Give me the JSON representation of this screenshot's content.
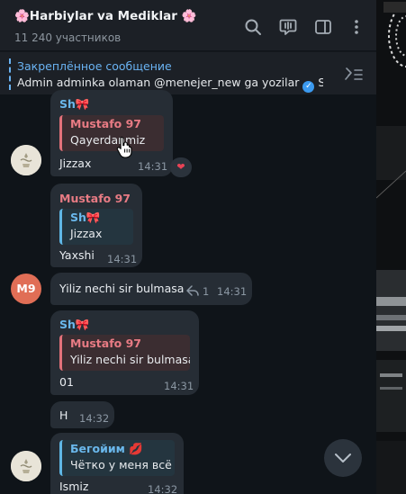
{
  "header": {
    "title": "🌸Harbiylar va Mediklar 🌸",
    "subtitle": "11 240 участников",
    "icons": [
      "search-icon",
      "live-chat-icon",
      "side-panel-icon",
      "more-vert-icon"
    ]
  },
  "pinned": {
    "title": "Закреплённое сообщение",
    "text_before": "Admin adminka olaman @menejer_new ga yozilar ",
    "text_after": " S..."
  },
  "messages": [
    {
      "sender": "Sh🎀",
      "reply_name": "Mustafo 97",
      "reply_text": "Qayerdanmiz",
      "text": "Jizzax",
      "time": "14:31",
      "reaction": "❤"
    },
    {
      "sender": "Mustafo 97",
      "reply_name": "Sh🎀",
      "reply_text": "Jizzax",
      "text": "Yaxshi",
      "time": "14:31"
    },
    {
      "avatar": "M9",
      "text": "Yiliz nechi sir bulmasa",
      "replies_count": "1",
      "time": "14:31"
    },
    {
      "sender": "Sh🎀",
      "reply_name": "Mustafo 97",
      "reply_text": "Yiliz nechi sir bulmasa",
      "text": "01",
      "time": "14:31"
    },
    {
      "text": "H",
      "time": "14:32"
    },
    {
      "reply_name": "Бегойим 💋",
      "reply_text": "Чётко у меня всё",
      "text": "Ismiz",
      "time": "14:32"
    }
  ],
  "colors": {
    "accent": "#6ab3f3",
    "bubble": "#262d35",
    "header": "#1c2026",
    "background": "#0f1419",
    "reply_red": "#e3717a",
    "reply_blue": "#5fb7e6",
    "avatar_m9": "#e06e56"
  }
}
